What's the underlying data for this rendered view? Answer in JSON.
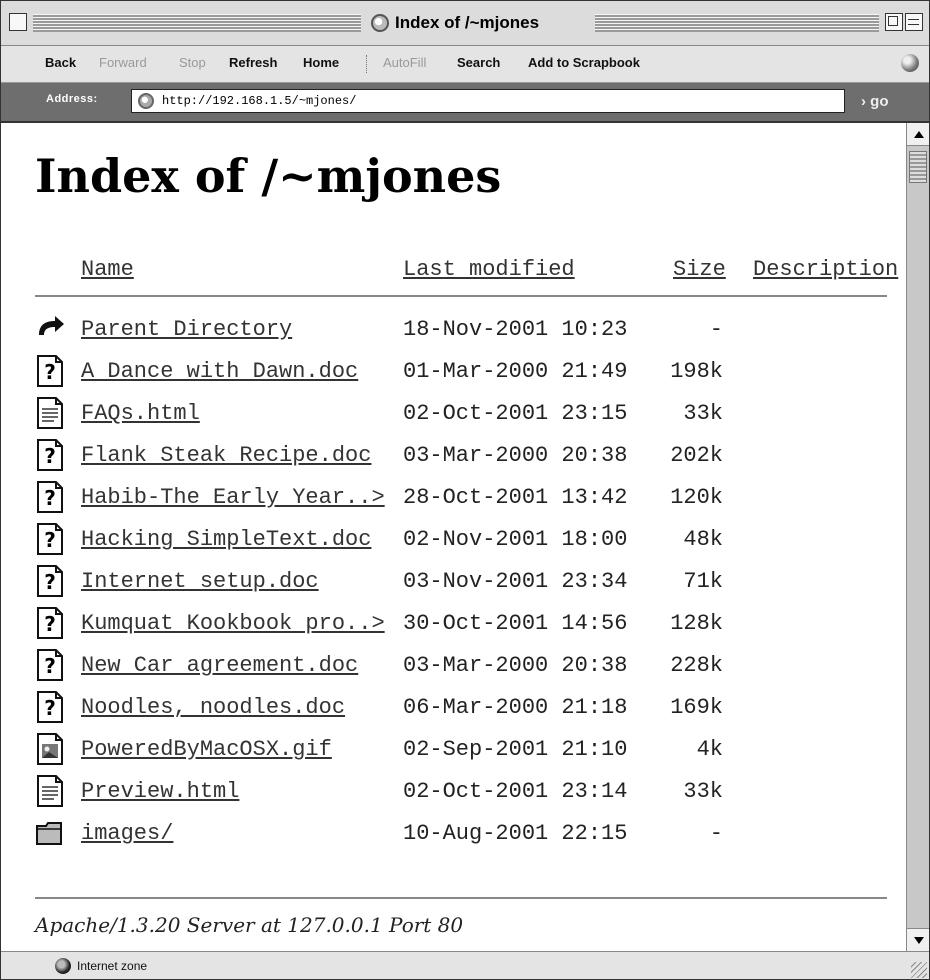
{
  "window": {
    "title": "Index of /~mjones"
  },
  "toolbar": {
    "back": "Back",
    "forward": "Forward",
    "stop": "Stop",
    "refresh": "Refresh",
    "home": "Home",
    "autofill": "AutoFill",
    "search": "Search",
    "scrapbook": "Add to Scrapbook"
  },
  "address": {
    "label": "Address:",
    "url": "http://192.168.1.5/~mjones/",
    "go": "go"
  },
  "page": {
    "heading": "Index of /~mjones",
    "columns": {
      "name": "Name",
      "last_modified": "Last modified",
      "size": "Size",
      "description": "Description"
    },
    "rows": [
      {
        "icon": "parent-directory-arrow-icon",
        "name": "Parent Directory",
        "modified": "18-Nov-2001 10:23",
        "size": "-"
      },
      {
        "icon": "unknown-file-icon",
        "name": "A Dance with Dawn.doc",
        "modified": "01-Mar-2000 21:49",
        "size": "198k"
      },
      {
        "icon": "text-file-icon",
        "name": "FAQs.html",
        "modified": "02-Oct-2001 23:15",
        "size": "33k"
      },
      {
        "icon": "unknown-file-icon",
        "name": "Flank Steak Recipe.doc",
        "modified": "03-Mar-2000 20:38",
        "size": "202k"
      },
      {
        "icon": "unknown-file-icon",
        "name": "Habib-The Early Year..>",
        "modified": "28-Oct-2001 13:42",
        "size": "120k"
      },
      {
        "icon": "unknown-file-icon",
        "name": "Hacking SimpleText.doc",
        "modified": "02-Nov-2001 18:00",
        "size": "48k"
      },
      {
        "icon": "unknown-file-icon",
        "name": "Internet setup.doc",
        "modified": "03-Nov-2001 23:34",
        "size": "71k"
      },
      {
        "icon": "unknown-file-icon",
        "name": "Kumquat Kookbook pro..>",
        "modified": "30-Oct-2001 14:56",
        "size": "128k"
      },
      {
        "icon": "unknown-file-icon",
        "name": "New Car agreement.doc",
        "modified": "03-Mar-2000 20:38",
        "size": "228k"
      },
      {
        "icon": "unknown-file-icon",
        "name": "Noodles, noodles.doc",
        "modified": "06-Mar-2000 21:18",
        "size": "169k"
      },
      {
        "icon": "image-file-icon",
        "name": "PoweredByMacOSX.gif",
        "modified": "02-Sep-2001 21:10",
        "size": "4k"
      },
      {
        "icon": "text-file-icon",
        "name": "Preview.html",
        "modified": "02-Oct-2001 23:14",
        "size": "33k"
      },
      {
        "icon": "folder-icon",
        "name": "images/",
        "modified": "10-Aug-2001 22:15",
        "size": "-"
      }
    ],
    "footer": "Apache/1.3.20 Server at 127.0.0.1 Port 80"
  },
  "status": {
    "zone": "Internet zone"
  }
}
